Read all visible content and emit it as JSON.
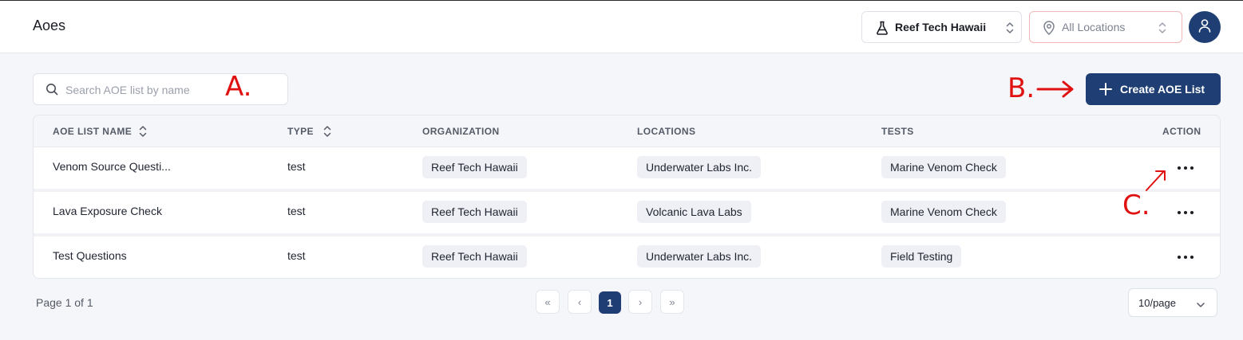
{
  "header": {
    "title": "Aoes",
    "organization": "Reef Tech Hawaii",
    "location": "All Locations"
  },
  "toolbar": {
    "search_placeholder": "Search AOE list by name",
    "create_label": "Create AOE List"
  },
  "annotations": {
    "a": "A.",
    "b": "B.",
    "c": "C."
  },
  "table": {
    "columns": [
      "AOE LIST NAME",
      "TYPE",
      "ORGANIZATION",
      "LOCATIONS",
      "TESTS",
      "ACTION"
    ],
    "rows": [
      {
        "name": "Venom Source Questi...",
        "type": "test",
        "organization": "Reef Tech Hawaii",
        "location": "Underwater Labs Inc.",
        "test": "Marine Venom Check"
      },
      {
        "name": "Lava Exposure Check",
        "type": "test",
        "organization": "Reef Tech Hawaii",
        "location": "Volcanic Lava Labs",
        "test": "Marine Venom Check"
      },
      {
        "name": "Test Questions",
        "type": "test",
        "organization": "Reef Tech Hawaii",
        "location": "Underwater Labs Inc.",
        "test": "Field Testing"
      }
    ]
  },
  "pagination": {
    "info": "Page 1 of 1",
    "first": "«",
    "prev": "‹",
    "current": "1",
    "next": "›",
    "last": "»",
    "per_page": "10/page"
  },
  "colors": {
    "primary": "#1f3f74",
    "annotation": "#e01111",
    "background": "#f5f6fa"
  }
}
